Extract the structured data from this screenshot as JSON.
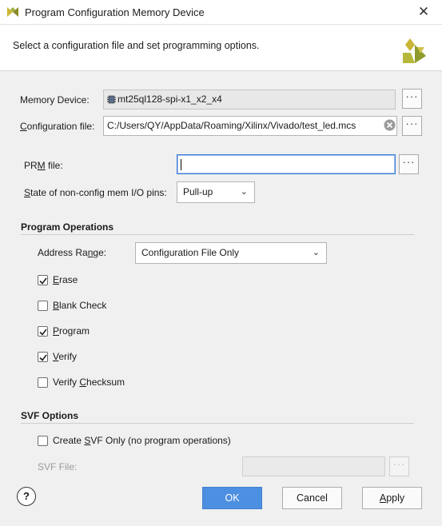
{
  "window": {
    "title": "Program Configuration Memory Device",
    "close_glyph": "✕"
  },
  "banner": {
    "text": "Select a configuration file and set programming options."
  },
  "memory_device": {
    "label": "Memory Device:",
    "value": "mt25ql128-spi-x1_x2_x4",
    "icon": "chip-icon"
  },
  "configuration_file": {
    "label_pre": "",
    "label_mnemonic": "C",
    "label_post": "onfiguration file:",
    "value": "C:/Users/QY/AppData/Roaming/Xilinx/Vivado/test_led.mcs",
    "clear_icon": "clear-icon"
  },
  "prm_file": {
    "label_pre": "PR",
    "label_mnemonic": "M",
    "label_post": " file:",
    "value": ""
  },
  "non_config_pins": {
    "label_pre": "",
    "label_mnemonic": "S",
    "label_post": "tate of non-config mem I/O pins:",
    "selected": "Pull-up"
  },
  "browse_button_label": "···",
  "program_operations": {
    "title": "Program Operations",
    "address_range": {
      "label_pre": "Address Ra",
      "label_mnemonic": "n",
      "label_post": "ge:",
      "selected": "Configuration File Only"
    },
    "checkboxes": [
      {
        "pre": "",
        "mn": "E",
        "post": "rase",
        "checked": true
      },
      {
        "pre": "",
        "mn": "B",
        "post": "lank Check",
        "checked": false
      },
      {
        "pre": "",
        "mn": "P",
        "post": "rogram",
        "checked": true
      },
      {
        "pre": "",
        "mn": "V",
        "post": "erify",
        "checked": true
      },
      {
        "pre": "Verify ",
        "mn": "C",
        "post": "hecksum",
        "checked": false
      }
    ]
  },
  "svf_options": {
    "title": "SVF Options",
    "create_svf": {
      "pre": "Create ",
      "mn": "S",
      "post": "VF Only (no program operations)",
      "checked": false
    },
    "svf_file_label": "SVF File:",
    "svf_file_value": ""
  },
  "buttons": {
    "help": "?",
    "ok": "OK",
    "cancel": "Cancel",
    "apply_mn": "A",
    "apply_post": "pply"
  },
  "colors": {
    "primary_button": "#4d8fe0",
    "focus_border": "#3d7ad6",
    "logo_yellow": "#c9b638"
  }
}
